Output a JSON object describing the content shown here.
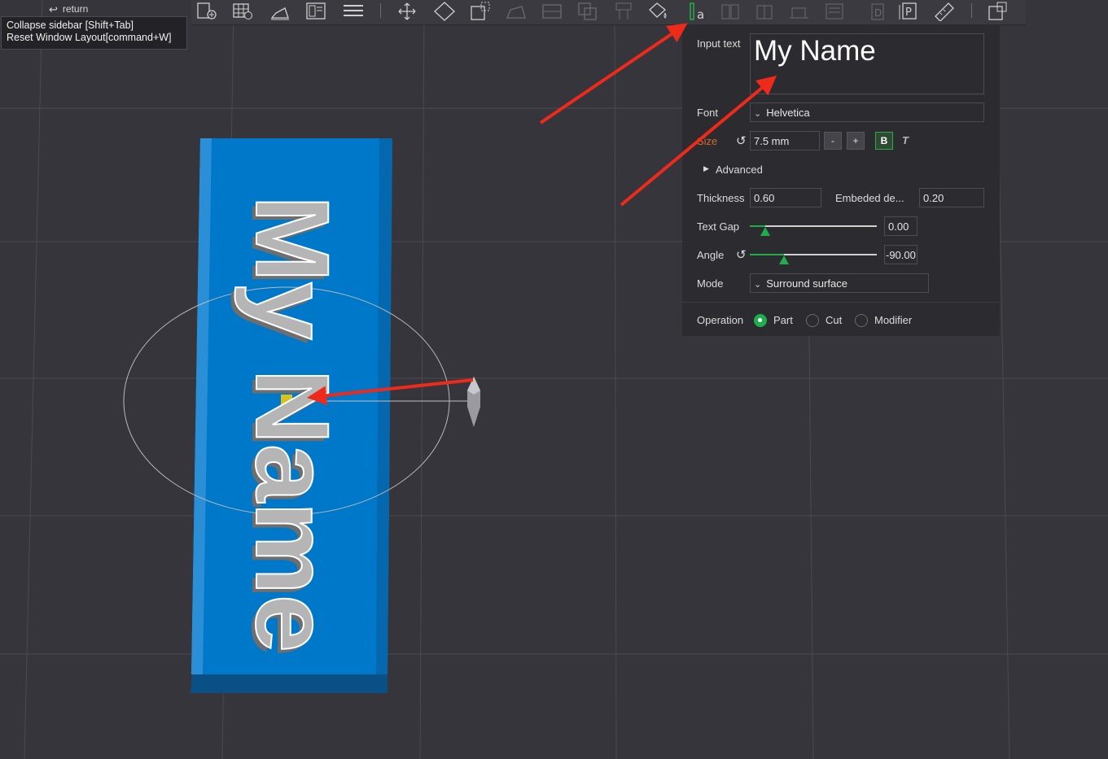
{
  "window": {
    "return_label": "return"
  },
  "tooltip": {
    "line1": "Collapse sidebar [Shift+Tab]",
    "line2": "Reset Window Layout[command+W]"
  },
  "toolbar": {
    "icons": [
      "add-plate-icon",
      "arrange-grid-icon",
      "orient-icon",
      "layout-icon",
      "layers-icon",
      "move-icon",
      "rotate-icon",
      "scale-icon",
      "lay-on-face-icon",
      "cut-icon",
      "mesh-boolean-icon",
      "support-paint-icon",
      "seam-paint-icon",
      "color-paint-icon",
      "emboss-text-icon",
      "split-objects-icon",
      "split-parts-icon",
      "variable-layer-icon",
      "assembly-icon",
      "measure-icon",
      "explode-icon"
    ]
  },
  "panel": {
    "input_text_label": "Input text",
    "input_text_value": "My Name",
    "font_label": "Font",
    "font_value": "Helvetica",
    "size_label": "Size",
    "size_value": "7.5 mm",
    "minus_label": "-",
    "plus_label": "+",
    "bold_label": "B",
    "italic_label": "T",
    "advanced_label": "Advanced",
    "thickness_label": "Thickness",
    "thickness_value": "0.60",
    "embeded_label": "Embeded de...",
    "embeded_value": "0.20",
    "text_gap_label": "Text Gap",
    "text_gap_value": "0.00",
    "text_gap_fraction": 0.12,
    "angle_label": "Angle",
    "angle_value": "-90.00",
    "angle_fraction": 0.27,
    "mode_label": "Mode",
    "mode_value": "Surround surface",
    "operation_label": "Operation",
    "operations": [
      {
        "label": "Part",
        "selected": true
      },
      {
        "label": "Cut",
        "selected": false
      },
      {
        "label": "Modifier",
        "selected": false
      }
    ]
  },
  "model": {
    "embossed_text": "My Name"
  },
  "colors": {
    "accent": "#1fae4b",
    "plate": "#0077c8",
    "annotation_arrow": "#ee2a1b",
    "background": "#35353b"
  }
}
